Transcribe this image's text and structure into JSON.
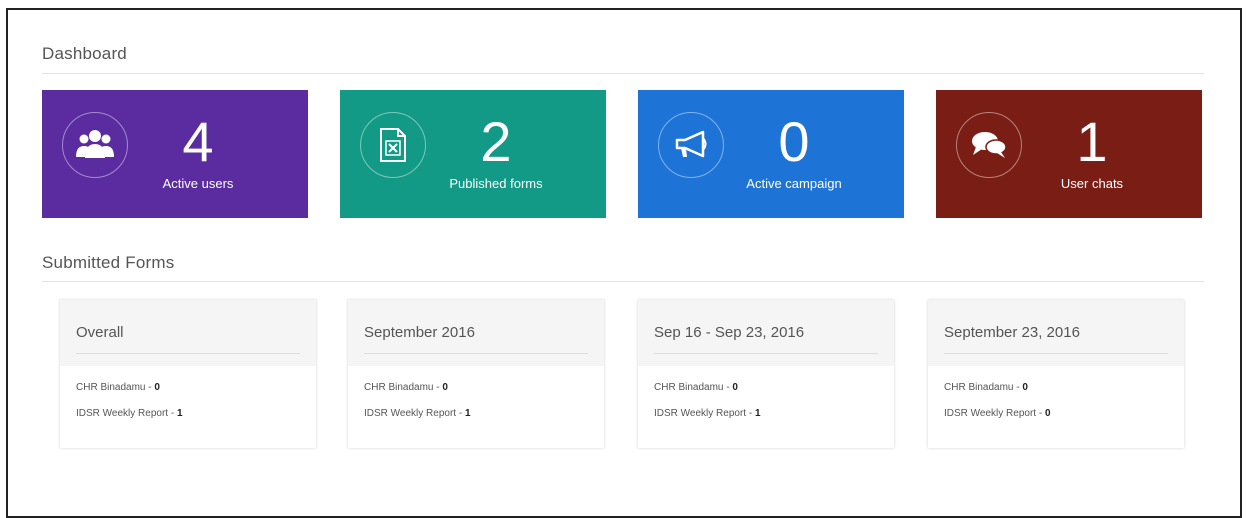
{
  "dashboard": {
    "title": "Dashboard"
  },
  "stats": [
    {
      "count": "4",
      "label": "Active users",
      "icon": "users-icon",
      "color": "#5a2ca0"
    },
    {
      "count": "2",
      "label": "Published forms",
      "icon": "excel-file-icon",
      "color": "#129a86"
    },
    {
      "count": "0",
      "label": "Active campaign",
      "icon": "megaphone-icon",
      "color": "#1e73d6"
    },
    {
      "count": "1",
      "label": "User chats",
      "icon": "chat-bubbles-icon",
      "color": "#7a1e15"
    }
  ],
  "submitted_forms": {
    "title": "Submitted Forms",
    "cards": [
      {
        "title": "Overall",
        "rows": [
          {
            "name": "CHR Binadamu",
            "sep": " - ",
            "value": "0"
          },
          {
            "name": "IDSR Weekly Report",
            "sep": " - ",
            "value": "1"
          }
        ]
      },
      {
        "title": "September 2016",
        "rows": [
          {
            "name": "CHR Binadamu",
            "sep": " - ",
            "value": "0"
          },
          {
            "name": "IDSR Weekly Report",
            "sep": " - ",
            "value": "1"
          }
        ]
      },
      {
        "title": "Sep 16 - Sep 23, 2016",
        "rows": [
          {
            "name": "CHR Binadamu",
            "sep": " - ",
            "value": "0"
          },
          {
            "name": "IDSR Weekly Report",
            "sep": " - ",
            "value": "1"
          }
        ]
      },
      {
        "title": "September 23, 2016",
        "rows": [
          {
            "name": "CHR Binadamu",
            "sep": " - ",
            "value": "0"
          },
          {
            "name": "IDSR Weekly Report",
            "sep": " - ",
            "value": "0"
          }
        ]
      }
    ]
  }
}
